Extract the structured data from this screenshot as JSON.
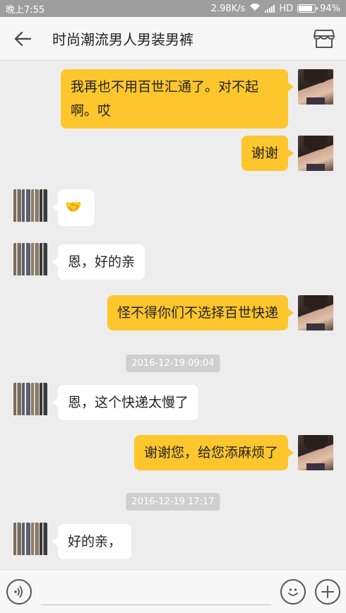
{
  "status_bar": {
    "time": "晚上7:55",
    "network_speed": "2.98K/s",
    "network_type": "HD",
    "battery": "94%",
    "battery_level": 0.94
  },
  "header": {
    "title": "时尚潮流男人男装男裤",
    "back_icon": "back-arrow-icon",
    "shop_icon": "store-icon"
  },
  "messages": [
    {
      "from": "me",
      "text": "我再也不用百世汇通了。对不起啊。哎"
    },
    {
      "from": "me",
      "text": "谢谢"
    },
    {
      "from": "shop",
      "text": "🤝"
    },
    {
      "from": "shop",
      "text": "恩，好的亲"
    },
    {
      "from": "me",
      "text": "怪不得你们不选择百世快递"
    },
    {
      "type": "timestamp",
      "text": "2016-12-19 09:04"
    },
    {
      "from": "shop",
      "text": "恩，这个快递太慢了"
    },
    {
      "from": "me",
      "text": "谢谢您，给您添麻烦了"
    },
    {
      "type": "timestamp",
      "text": "2016-12-19 17:17"
    },
    {
      "from": "shop",
      "text": "好的亲，"
    }
  ],
  "input_bar": {
    "placeholder": "",
    "voice_icon": "voice-icon",
    "emoji_icon": "emoji-icon",
    "plus_icon": "plus-icon"
  },
  "colors": {
    "my_bubble": "#fdc62d",
    "shop_bubble": "#ffffff",
    "background": "#ededed"
  }
}
